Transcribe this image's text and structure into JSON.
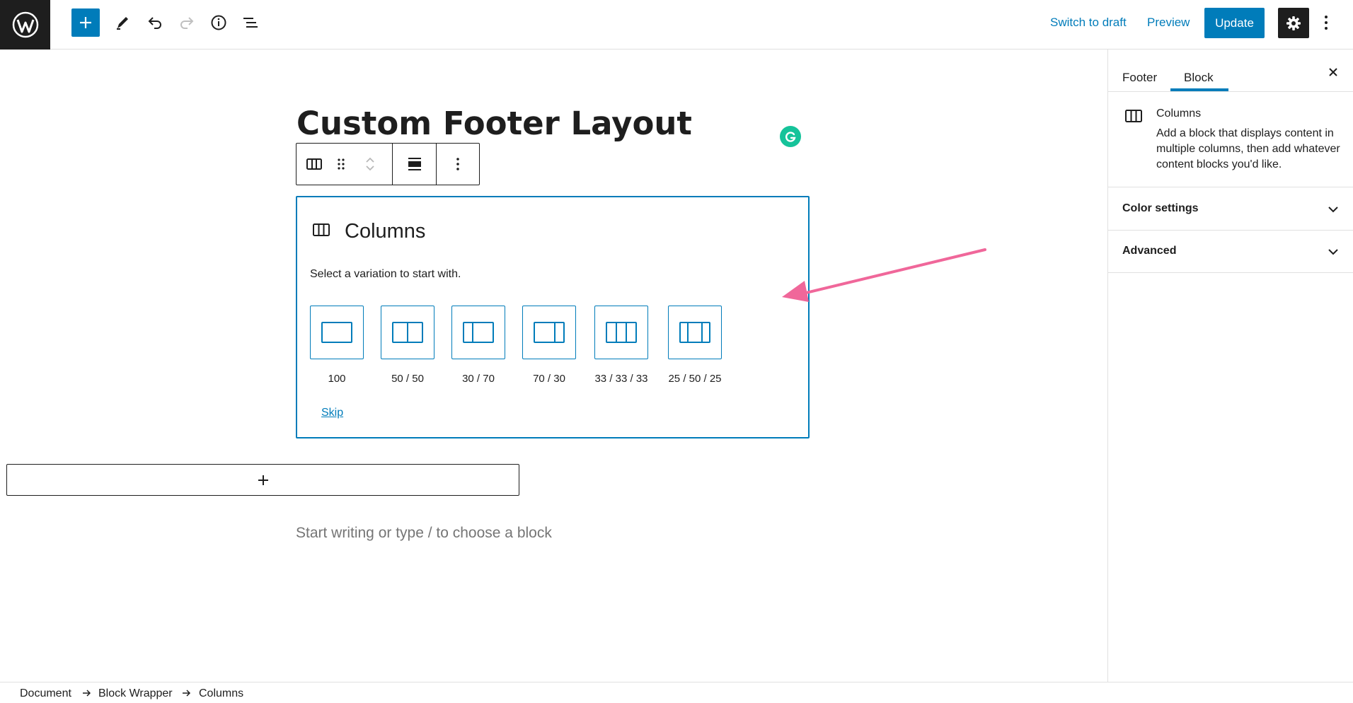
{
  "topbar": {
    "logo": "wordpress-logo",
    "icons": [
      "plus-icon",
      "pencil-icon",
      "undo-icon",
      "redo-icon",
      "info-icon",
      "list-view-icon"
    ],
    "switch_to_draft": "Switch to draft",
    "preview": "Preview",
    "update": "Update",
    "settings_icon": "gear-icon",
    "more_icon": "more-vertical-icon"
  },
  "editor": {
    "title": "Custom Footer Layout",
    "placeholder": "Start writing or type / to choose a block"
  },
  "columns_block": {
    "title": "Columns",
    "instructions": "Select a variation to start with.",
    "variations": [
      {
        "label": "100"
      },
      {
        "label": "50 / 50"
      },
      {
        "label": "30 / 70"
      },
      {
        "label": "70 / 30"
      },
      {
        "label": "33 / 33 / 33"
      },
      {
        "label": "25 / 50 / 25"
      }
    ],
    "skip": "Skip"
  },
  "sidebar": {
    "tabs": [
      "Footer",
      "Block"
    ],
    "active_tab": "Block",
    "block_card": {
      "title": "Columns",
      "description": "Add a block that displays content in multiple columns, then add whatever content blocks you'd like."
    },
    "panels": [
      "Color settings",
      "Advanced"
    ]
  },
  "breadcrumb": [
    "Document",
    "Block Wrapper",
    "Columns"
  ],
  "colors": {
    "accent": "#007cba",
    "dark": "#1e1e1e",
    "annotation_arrow": "#f0679a",
    "grammarly": "#15c39a"
  }
}
